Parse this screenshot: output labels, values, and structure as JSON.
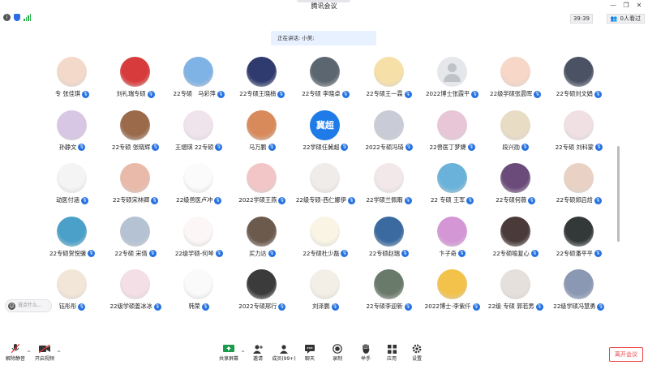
{
  "window": {
    "title": "腾讯会议",
    "controls": [
      "minimize-icon",
      "restore-icon",
      "close-icon"
    ]
  },
  "info_bar": {
    "timer": "39:39",
    "viewers": "0人看过"
  },
  "speaking": "正在讲话: 小美;",
  "participants": [
    {
      "name": "专 张佳琪"
    },
    {
      "name": "刘礼瑞专硕"
    },
    {
      "name": "22专硕　马彩萍"
    },
    {
      "name": "22专硕王晓楠"
    },
    {
      "name": "22专硕 李晓卓"
    },
    {
      "name": "22专硕王一霖"
    },
    {
      "name": "2022博士张霞平"
    },
    {
      "name": "22级学硕张晨晖"
    },
    {
      "name": "22专硕刘文娟"
    },
    {
      "name": "孙静文"
    },
    {
      "name": "22专硕 张晓辉"
    },
    {
      "name": "王熠琪 22专硕"
    },
    {
      "name": "马万鹏"
    },
    {
      "name": "22学硕任冀超",
      "avatar_text": "冀超"
    },
    {
      "name": "2022专硕冯琦"
    },
    {
      "name": "22兽医丁梦婕"
    },
    {
      "name": "段兴勋"
    },
    {
      "name": "22专硕 刘科蒙"
    },
    {
      "name": "动医付涵"
    },
    {
      "name": "22专硕宋林卿"
    },
    {
      "name": "22级兽医卢冲"
    },
    {
      "name": "2022学硕王燕"
    },
    {
      "name": "22级专硕-西仁娜伊"
    },
    {
      "name": "22学硕兰佩暇"
    },
    {
      "name": "22 专硕 王军"
    },
    {
      "name": "22专硕何薇"
    },
    {
      "name": "22专硕郑启焓"
    },
    {
      "name": "22专硕贺悦骥"
    },
    {
      "name": "22专硕 宋倩"
    },
    {
      "name": "22级学硕-何琴"
    },
    {
      "name": "买力达"
    },
    {
      "name": "22专硕杜少磊"
    },
    {
      "name": "22专硕赵瑞"
    },
    {
      "name": "卞子奇"
    },
    {
      "name": "22专硕喻复心"
    },
    {
      "name": "22专硕潘平平"
    },
    {
      "name": "钰彤彤"
    },
    {
      "name": "22级学硕姜冰冰"
    },
    {
      "name": "韩荣"
    },
    {
      "name": "2022专硕邢行"
    },
    {
      "name": "刘泽鹏"
    },
    {
      "name": "22专硕李迎新"
    },
    {
      "name": "2022博士-李紫仟"
    },
    {
      "name": "22级 专硕 郭若男"
    },
    {
      "name": "22级学硕冯慧勇"
    }
  ],
  "chat_placeholder": "说点什么...",
  "toolbar": {
    "mute": "解除静音",
    "video": "开启视频",
    "share": "共享屏幕",
    "invite": "邀请",
    "members": "成员(99+)",
    "chat": "聊天",
    "record": "录制",
    "raise_hand": "举手",
    "apps": "应用",
    "settings": "设置",
    "leave": "离开会议"
  },
  "colors": {
    "accent": "#2672e0",
    "leave": "#e44444"
  }
}
